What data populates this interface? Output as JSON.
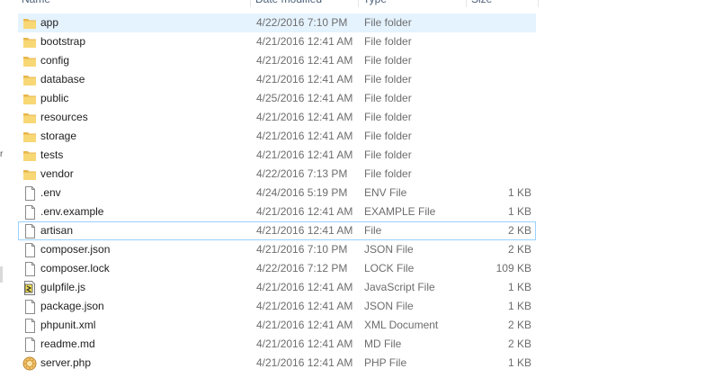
{
  "columns": {
    "name": "Name",
    "date": "Date modified",
    "type": "Type",
    "size": "Size"
  },
  "files": [
    {
      "name": "app",
      "date": "4/22/2016 7:10 PM",
      "type": "File folder",
      "size": "",
      "icon": "folder-icon",
      "selected": true
    },
    {
      "name": "bootstrap",
      "date": "4/21/2016 12:41 AM",
      "type": "File folder",
      "size": "",
      "icon": "folder-icon"
    },
    {
      "name": "config",
      "date": "4/21/2016 12:41 AM",
      "type": "File folder",
      "size": "",
      "icon": "folder-icon"
    },
    {
      "name": "database",
      "date": "4/21/2016 12:41 AM",
      "type": "File folder",
      "size": "",
      "icon": "folder-icon"
    },
    {
      "name": "public",
      "date": "4/25/2016 12:41 AM",
      "type": "File folder",
      "size": "",
      "icon": "folder-icon"
    },
    {
      "name": "resources",
      "date": "4/21/2016 12:41 AM",
      "type": "File folder",
      "size": "",
      "icon": "folder-icon"
    },
    {
      "name": "storage",
      "date": "4/21/2016 12:41 AM",
      "type": "File folder",
      "size": "",
      "icon": "folder-icon"
    },
    {
      "name": "tests",
      "date": "4/21/2016 12:41 AM",
      "type": "File folder",
      "size": "",
      "icon": "folder-icon"
    },
    {
      "name": "vendor",
      "date": "4/22/2016 7:13 PM",
      "type": "File folder",
      "size": "",
      "icon": "folder-icon"
    },
    {
      "name": ".env",
      "date": "4/24/2016 5:19 PM",
      "type": "ENV File",
      "size": "1 KB",
      "icon": "file-icon"
    },
    {
      "name": ".env.example",
      "date": "4/21/2016 12:41 AM",
      "type": "EXAMPLE File",
      "size": "1 KB",
      "icon": "file-icon"
    },
    {
      "name": "artisan",
      "date": "4/21/2016 12:41 AM",
      "type": "File",
      "size": "2 KB",
      "icon": "file-icon",
      "focused": true
    },
    {
      "name": "composer.json",
      "date": "4/21/2016 7:10 PM",
      "type": "JSON File",
      "size": "2 KB",
      "icon": "file-icon"
    },
    {
      "name": "composer.lock",
      "date": "4/22/2016 7:12 PM",
      "type": "LOCK File",
      "size": "109 KB",
      "icon": "file-icon"
    },
    {
      "name": "gulpfile.js",
      "date": "4/21/2016 12:41 AM",
      "type": "JavaScript File",
      "size": "1 KB",
      "icon": "js-file-icon"
    },
    {
      "name": "package.json",
      "date": "4/21/2016 12:41 AM",
      "type": "JSON File",
      "size": "1 KB",
      "icon": "file-icon"
    },
    {
      "name": "phpunit.xml",
      "date": "4/21/2016 12:41 AM",
      "type": "XML Document",
      "size": "2 KB",
      "icon": "file-icon"
    },
    {
      "name": "readme.md",
      "date": "4/21/2016 12:41 AM",
      "type": "MD File",
      "size": "2 KB",
      "icon": "file-icon"
    },
    {
      "name": "server.php",
      "date": "4/21/2016 12:41 AM",
      "type": "PHP File",
      "size": "1 KB",
      "icon": "php-file-icon"
    }
  ],
  "colors": {
    "selected_bg": "#e5f3ff",
    "focus_border": "#99d1ff",
    "folder": "#f8d775",
    "header_text": "#4c607a"
  }
}
